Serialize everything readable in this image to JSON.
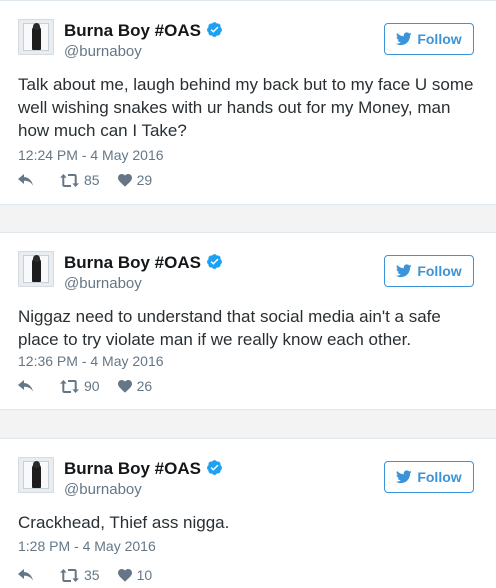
{
  "account": {
    "name": "Burna Boy #OAS",
    "handle": "@burnaboy",
    "follow_label": "Follow"
  },
  "colors": {
    "accent": "#3b94d9",
    "verified": "#1da1f2",
    "text": "#292f33",
    "muted": "#657786"
  },
  "icons": [
    "verified-badge-icon",
    "twitter-bird-icon",
    "reply-icon",
    "retweet-icon",
    "heart-icon"
  ],
  "tweets": [
    {
      "text": "Talk about me, laugh behind my back but to my face U some well wishing snakes with ur hands out for my Money, man how much can I Take?",
      "time": "12:24 PM - 4 May 2016",
      "retweets": "85",
      "likes": "29"
    },
    {
      "text": "Niggaz need to understand that social media ain't a safe place to try violate man if we really know each other.",
      "time": "12:36 PM - 4 May 2016",
      "retweets": "90",
      "likes": "26"
    },
    {
      "text": "Crackhead, Thief ass nigga.",
      "time": "1:28 PM - 4 May 2016",
      "retweets": "35",
      "likes": "10"
    }
  ]
}
